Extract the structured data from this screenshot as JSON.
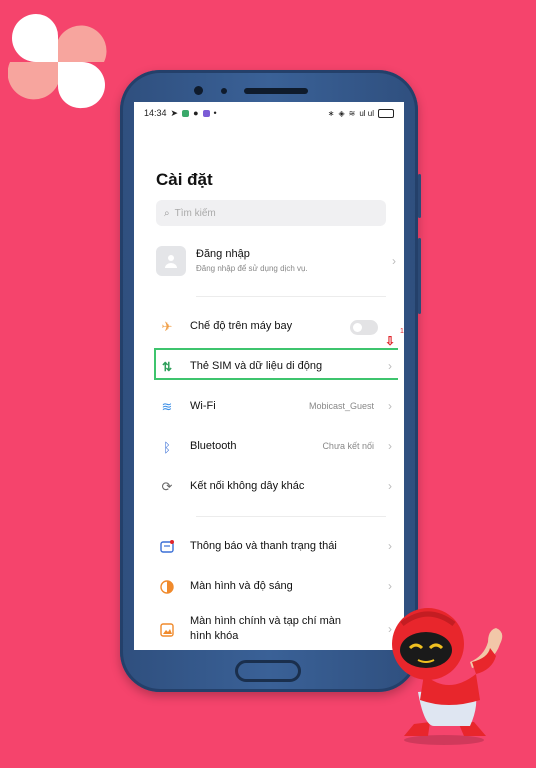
{
  "status_bar": {
    "time": "14:34",
    "signal_text": "ul ul"
  },
  "settings": {
    "title": "Cài đặt",
    "search_placeholder": "Tìm kiếm",
    "login": {
      "title": "Đăng nhập",
      "subtitle": "Đăng nhập để sử dụng dịch vụ."
    },
    "rows": [
      {
        "icon": "airplane-icon",
        "label": "Chế độ trên máy bay",
        "value": "",
        "control": "toggle"
      },
      {
        "icon": "sim-data-icon",
        "label": "Thẻ SIM và dữ liệu di động",
        "value": ""
      },
      {
        "icon": "wifi-icon",
        "label": "Wi-Fi",
        "value": "Mobicast_Guest"
      },
      {
        "icon": "bluetooth-icon",
        "label": "Bluetooth",
        "value": "Chưa kết nối"
      },
      {
        "icon": "connection-icon",
        "label": "Kết nối không dây khác",
        "value": ""
      },
      {
        "icon": "notification-icon",
        "label": "Thông báo và thanh trạng thái",
        "value": ""
      },
      {
        "icon": "brightness-icon",
        "label": "Màn hình và độ sáng",
        "value": ""
      },
      {
        "icon": "wallpaper-icon",
        "label": "Màn hình chính và tạp chí màn\nhình khóa",
        "value": ""
      }
    ],
    "annotation": {
      "step_number": "1"
    }
  },
  "colors": {
    "background": "#f5446c",
    "highlight": "#3ec46d",
    "arrow": "#e0242a"
  }
}
